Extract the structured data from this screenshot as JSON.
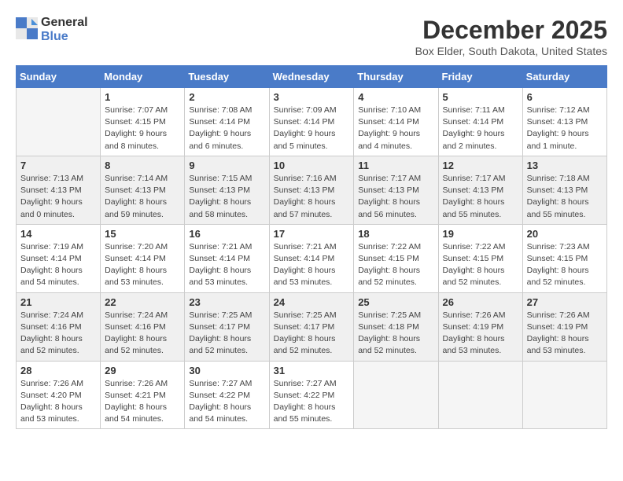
{
  "logo": {
    "general": "General",
    "blue": "Blue"
  },
  "title": "December 2025",
  "subtitle": "Box Elder, South Dakota, United States",
  "days_header": [
    "Sunday",
    "Monday",
    "Tuesday",
    "Wednesday",
    "Thursday",
    "Friday",
    "Saturday"
  ],
  "weeks": [
    [
      {
        "day": "",
        "info": ""
      },
      {
        "day": "1",
        "info": "Sunrise: 7:07 AM\nSunset: 4:15 PM\nDaylight: 9 hours\nand 8 minutes."
      },
      {
        "day": "2",
        "info": "Sunrise: 7:08 AM\nSunset: 4:14 PM\nDaylight: 9 hours\nand 6 minutes."
      },
      {
        "day": "3",
        "info": "Sunrise: 7:09 AM\nSunset: 4:14 PM\nDaylight: 9 hours\nand 5 minutes."
      },
      {
        "day": "4",
        "info": "Sunrise: 7:10 AM\nSunset: 4:14 PM\nDaylight: 9 hours\nand 4 minutes."
      },
      {
        "day": "5",
        "info": "Sunrise: 7:11 AM\nSunset: 4:14 PM\nDaylight: 9 hours\nand 2 minutes."
      },
      {
        "day": "6",
        "info": "Sunrise: 7:12 AM\nSunset: 4:13 PM\nDaylight: 9 hours\nand 1 minute."
      }
    ],
    [
      {
        "day": "7",
        "info": "Sunrise: 7:13 AM\nSunset: 4:13 PM\nDaylight: 9 hours\nand 0 minutes."
      },
      {
        "day": "8",
        "info": "Sunrise: 7:14 AM\nSunset: 4:13 PM\nDaylight: 8 hours\nand 59 minutes."
      },
      {
        "day": "9",
        "info": "Sunrise: 7:15 AM\nSunset: 4:13 PM\nDaylight: 8 hours\nand 58 minutes."
      },
      {
        "day": "10",
        "info": "Sunrise: 7:16 AM\nSunset: 4:13 PM\nDaylight: 8 hours\nand 57 minutes."
      },
      {
        "day": "11",
        "info": "Sunrise: 7:17 AM\nSunset: 4:13 PM\nDaylight: 8 hours\nand 56 minutes."
      },
      {
        "day": "12",
        "info": "Sunrise: 7:17 AM\nSunset: 4:13 PM\nDaylight: 8 hours\nand 55 minutes."
      },
      {
        "day": "13",
        "info": "Sunrise: 7:18 AM\nSunset: 4:13 PM\nDaylight: 8 hours\nand 55 minutes."
      }
    ],
    [
      {
        "day": "14",
        "info": "Sunrise: 7:19 AM\nSunset: 4:14 PM\nDaylight: 8 hours\nand 54 minutes."
      },
      {
        "day": "15",
        "info": "Sunrise: 7:20 AM\nSunset: 4:14 PM\nDaylight: 8 hours\nand 53 minutes."
      },
      {
        "day": "16",
        "info": "Sunrise: 7:21 AM\nSunset: 4:14 PM\nDaylight: 8 hours\nand 53 minutes."
      },
      {
        "day": "17",
        "info": "Sunrise: 7:21 AM\nSunset: 4:14 PM\nDaylight: 8 hours\nand 53 minutes."
      },
      {
        "day": "18",
        "info": "Sunrise: 7:22 AM\nSunset: 4:15 PM\nDaylight: 8 hours\nand 52 minutes."
      },
      {
        "day": "19",
        "info": "Sunrise: 7:22 AM\nSunset: 4:15 PM\nDaylight: 8 hours\nand 52 minutes."
      },
      {
        "day": "20",
        "info": "Sunrise: 7:23 AM\nSunset: 4:15 PM\nDaylight: 8 hours\nand 52 minutes."
      }
    ],
    [
      {
        "day": "21",
        "info": "Sunrise: 7:24 AM\nSunset: 4:16 PM\nDaylight: 8 hours\nand 52 minutes."
      },
      {
        "day": "22",
        "info": "Sunrise: 7:24 AM\nSunset: 4:16 PM\nDaylight: 8 hours\nand 52 minutes."
      },
      {
        "day": "23",
        "info": "Sunrise: 7:25 AM\nSunset: 4:17 PM\nDaylight: 8 hours\nand 52 minutes."
      },
      {
        "day": "24",
        "info": "Sunrise: 7:25 AM\nSunset: 4:17 PM\nDaylight: 8 hours\nand 52 minutes."
      },
      {
        "day": "25",
        "info": "Sunrise: 7:25 AM\nSunset: 4:18 PM\nDaylight: 8 hours\nand 52 minutes."
      },
      {
        "day": "26",
        "info": "Sunrise: 7:26 AM\nSunset: 4:19 PM\nDaylight: 8 hours\nand 53 minutes."
      },
      {
        "day": "27",
        "info": "Sunrise: 7:26 AM\nSunset: 4:19 PM\nDaylight: 8 hours\nand 53 minutes."
      }
    ],
    [
      {
        "day": "28",
        "info": "Sunrise: 7:26 AM\nSunset: 4:20 PM\nDaylight: 8 hours\nand 53 minutes."
      },
      {
        "day": "29",
        "info": "Sunrise: 7:26 AM\nSunset: 4:21 PM\nDaylight: 8 hours\nand 54 minutes."
      },
      {
        "day": "30",
        "info": "Sunrise: 7:27 AM\nSunset: 4:22 PM\nDaylight: 8 hours\nand 54 minutes."
      },
      {
        "day": "31",
        "info": "Sunrise: 7:27 AM\nSunset: 4:22 PM\nDaylight: 8 hours\nand 55 minutes."
      },
      {
        "day": "",
        "info": ""
      },
      {
        "day": "",
        "info": ""
      },
      {
        "day": "",
        "info": ""
      }
    ]
  ]
}
